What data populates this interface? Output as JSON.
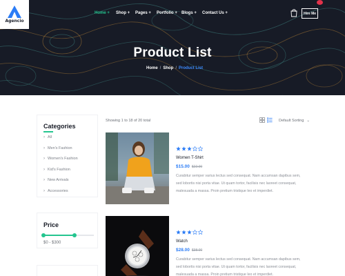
{
  "brand": {
    "name": "Agencio"
  },
  "nav": {
    "items": [
      {
        "label": "Home +",
        "active": true
      },
      {
        "label": "Shop +"
      },
      {
        "label": "Pages +"
      },
      {
        "label": "Portfolio +"
      },
      {
        "label": "Blogs +"
      },
      {
        "label": "Contact Us +"
      }
    ],
    "hire_label": "Hire Me",
    "icons": [
      "cart-icon"
    ]
  },
  "hero": {
    "title": "Product List",
    "breadcrumb": [
      "Home",
      "Shop",
      "Product List"
    ]
  },
  "sidebar": {
    "categories_title": "Categories",
    "categories": [
      "All",
      "Men's Fashion",
      "Women's Fashion",
      "Kid's Fashion",
      "New Arrivals",
      "Accessories"
    ],
    "price_title": "Price",
    "price_range": "$0 - $300",
    "price_slider": {
      "min_fraction": 0.0,
      "max_fraction": 0.61
    }
  },
  "toolbar": {
    "results_text": "Showing 1 to 18 of 20 total",
    "sort_label": "Default Sorting",
    "icons": [
      "grid-view-icon",
      "list-view-icon",
      "chevron-down-icon"
    ]
  },
  "products": [
    {
      "name": "Women T-Shirt",
      "price": "$15.00",
      "old_price": "$22.00",
      "rating": 3,
      "rating_max": 5,
      "description": "Curabitur semper varius lectus sed consequat. Nam accumsan dapibus sem, sed lobortis nisi porta vitae. Ut quam tortor, facilisis nec laoreet consequat, malesuada a massa. Proin pretium tristique leo et imperdiet."
    },
    {
      "name": "Watch",
      "price": "$28.00",
      "old_price": "$38.00",
      "rating": 3,
      "rating_max": 5,
      "description": "Curabitur semper varius lectus sed consequat. Nam accumsan dapibus sem, sed lobortis nisi porta vitae. Ut quam tortor, facilisis nec laoreet consequat, malesuada a massa. Proin pretium tristique leo et imperdiet."
    }
  ],
  "colors": {
    "accent": "#24c58f",
    "primary": "#2b7cf6",
    "hero_bg": "#171b26",
    "star": "#2b7cf6"
  }
}
